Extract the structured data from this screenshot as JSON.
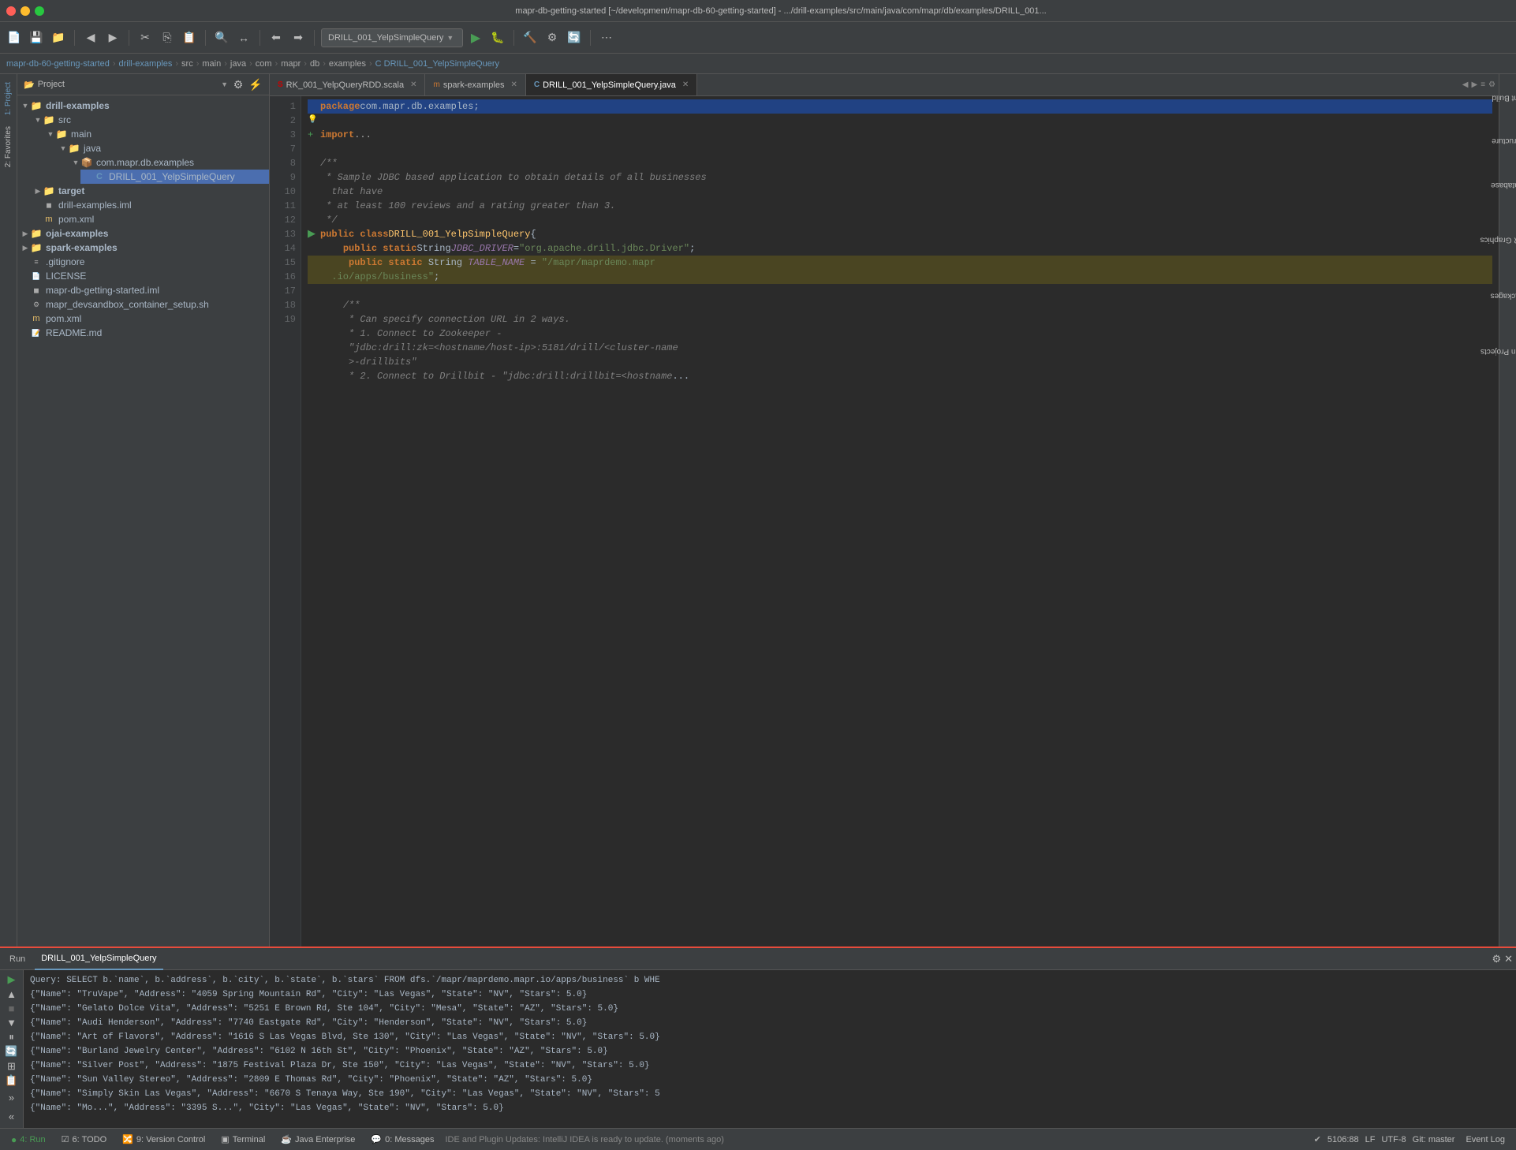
{
  "titleBar": {
    "title": "mapr-db-getting-started [~/development/mapr-db-60-getting-started] - .../drill-examples/src/main/java/com/mapr/db/examples/DRILL_001..."
  },
  "toolbar": {
    "runConfig": "DRILL_001_YelpSimpleQuery"
  },
  "breadcrumb": {
    "items": [
      "mapr-db-60-getting-started",
      "drill-examples",
      "src",
      "main",
      "java",
      "com",
      "mapr",
      "db",
      "examples",
      "DRILL_001_YelpSimpleQuery"
    ]
  },
  "projectPanel": {
    "title": "Project",
    "tree": [
      {
        "id": "drill-examples",
        "label": "drill-examples",
        "type": "folder",
        "indent": 0,
        "expanded": true,
        "bold": true
      },
      {
        "id": "src",
        "label": "src",
        "type": "folder",
        "indent": 1,
        "expanded": true
      },
      {
        "id": "main",
        "label": "main",
        "type": "folder",
        "indent": 2,
        "expanded": true
      },
      {
        "id": "java",
        "label": "java",
        "type": "folder-blue",
        "indent": 3,
        "expanded": true
      },
      {
        "id": "com.mapr.db.examples",
        "label": "com.mapr.db.examples",
        "type": "package",
        "indent": 4,
        "expanded": true
      },
      {
        "id": "DRILL_001_YelpSimpleQuery",
        "label": "DRILL_001_YelpSimpleQuery",
        "type": "java",
        "indent": 5,
        "selected": true
      },
      {
        "id": "target",
        "label": "target",
        "type": "folder",
        "indent": 1,
        "expanded": false,
        "bold": true
      },
      {
        "id": "drill-examples.iml",
        "label": "drill-examples.iml",
        "type": "iml",
        "indent": 1
      },
      {
        "id": "pom.xml-drill",
        "label": "pom.xml",
        "type": "xml",
        "indent": 1
      },
      {
        "id": "ojai-examples",
        "label": "ojai-examples",
        "type": "folder",
        "indent": 0,
        "expanded": false,
        "bold": true
      },
      {
        "id": "spark-examples",
        "label": "spark-examples",
        "type": "folder",
        "indent": 0,
        "expanded": false,
        "bold": true
      },
      {
        "id": ".gitignore",
        "label": ".gitignore",
        "type": "gitignore",
        "indent": 0
      },
      {
        "id": "LICENSE",
        "label": "LICENSE",
        "type": "file",
        "indent": 0
      },
      {
        "id": "mapr-db-getting-started.iml",
        "label": "mapr-db-getting-started.iml",
        "type": "iml",
        "indent": 0
      },
      {
        "id": "mapr_devsandbox_container_setup.sh",
        "label": "mapr_devsandbox_container_setup.sh",
        "type": "sh",
        "indent": 0
      },
      {
        "id": "pom.xml-root",
        "label": "pom.xml",
        "type": "xml",
        "indent": 0
      },
      {
        "id": "README.md",
        "label": "README.md",
        "type": "md",
        "indent": 0
      }
    ]
  },
  "editorTabs": [
    {
      "id": "tab-scala",
      "label": "RK_001_YelpQueryRDD.scala",
      "type": "scala",
      "active": false
    },
    {
      "id": "tab-spark",
      "label": "spark-examples",
      "type": "m",
      "active": false
    },
    {
      "id": "tab-java",
      "label": "DRILL_001_YelpSimpleQuery.java",
      "type": "java",
      "active": true
    }
  ],
  "codeLines": [
    {
      "num": 1,
      "content": "package_line",
      "gutter": "none"
    },
    {
      "num": 2,
      "content": "bulb_line",
      "gutter": "bulb"
    },
    {
      "num": 3,
      "content": "import_line",
      "gutter": "arrow"
    },
    {
      "num": 7,
      "content": "blank",
      "gutter": "none"
    },
    {
      "num": 8,
      "content": "comment_open",
      "gutter": "none"
    },
    {
      "num": 9,
      "content": "comment_1",
      "gutter": "none"
    },
    {
      "num": 10,
      "content": "comment_2",
      "gutter": "none"
    },
    {
      "num": 11,
      "content": "comment_close",
      "gutter": "none"
    },
    {
      "num": 12,
      "content": "class_line",
      "gutter": "run"
    },
    {
      "num": 13,
      "content": "jdbc_driver",
      "gutter": "none"
    },
    {
      "num": 14,
      "content": "table_name",
      "gutter": "none"
    },
    {
      "num": 15,
      "content": "blank2",
      "gutter": "none"
    },
    {
      "num": 16,
      "content": "comment2_open",
      "gutter": "none"
    },
    {
      "num": 17,
      "content": "comment2_1",
      "gutter": "none"
    },
    {
      "num": 18,
      "content": "comment2_2",
      "gutter": "none"
    },
    {
      "num": 19,
      "content": "url_line",
      "gutter": "none"
    }
  ],
  "runPanel": {
    "tabs": [
      {
        "id": "run-tab",
        "label": "Run",
        "active": false
      },
      {
        "id": "drill-tab",
        "label": "DRILL_001_YelpSimpleQuery",
        "active": true
      }
    ],
    "output": [
      "Query: SELECT b.`name`, b.`address`, b.`city`, b.`state`, b.`stars` FROM dfs.`/mapr/maprdemo.mapr.io/apps/business` b WHE",
      "{\"Name\": \"TruVape\", \"Address\": \"4059 Spring Mountain Rd\", \"City\": \"Las Vegas\", \"State\": \"NV\", \"Stars\": 5.0}",
      "{\"Name\": \"Gelato Dolce Vita\", \"Address\": \"5251 E Brown Rd, Ste 104\", \"City\": \"Mesa\", \"State\": \"AZ\", \"Stars\": 5.0}",
      "{\"Name\": \"Audi Henderson\", \"Address\": \"7740 Eastgate Rd\", \"City\": \"Henderson\", \"State\": \"NV\", \"Stars\": 5.0}",
      "{\"Name\": \"Art of Flavors\", \"Address\": \"1616 S Las Vegas Blvd, Ste 130\", \"City\": \"Las Vegas\", \"State\": \"NV\", \"Stars\": 5.0}",
      "{\"Name\": \"Burland Jewelry Center\", \"Address\": \"6102 N 16th St\", \"City\": \"Phoenix\", \"State\": \"AZ\", \"Stars\": 5.0}",
      "{\"Name\": \"Silver Post\", \"Address\": \"1875 Festival Plaza Dr, Ste 150\", \"City\": \"Las Vegas\", \"State\": \"NV\", \"Stars\": 5.0}",
      "{\"Name\": \"Sun Valley Stereo\", \"Address\": \"2809 E Thomas Rd\", \"City\": \"Phoenix\", \"State\": \"AZ\", \"Stars\": 5.0}",
      "{\"Name\": \"Simply Skin Las Vegas\", \"Address\": \"6670 S Tenaya Way, Ste 190\", \"City\": \"Las Vegas\", \"State\": \"NV\", \"Stars\": 5",
      "{\"Name\": \"Mo...\", \"Address\": \"3395 S...\", \"City\": \"Las Vegas\", \"State\": \"NV\", \"Stars\": 5.0}"
    ]
  },
  "statusBar": {
    "runLabel": "4: Run",
    "todoLabel": "6: TODO",
    "vcLabel": "9: Version Control",
    "terminalLabel": "Terminal",
    "javaEnterpriseLabel": "Java Enterprise",
    "messagesLabel": "0: Messages",
    "eventLogLabel": "Event Log",
    "position": "5106:88",
    "lineEnding": "LF",
    "encoding": "UTF-8",
    "gitBranch": "Git: master",
    "ideMessage": "IDE and Plugin Updates: IntelliJ IDEA is ready to update. (moments ago)"
  },
  "sideTabs": {
    "left": [
      "1: Project",
      "2: Favorites"
    ],
    "right": [
      "Ant Build",
      "Structure",
      "Database",
      "The R Graphics",
      "Packages",
      "Maven Projects"
    ]
  },
  "colors": {
    "accent": "#6897bb",
    "runGreen": "#499c54",
    "errorRed": "#e74c3c",
    "warning": "#d5a726"
  }
}
